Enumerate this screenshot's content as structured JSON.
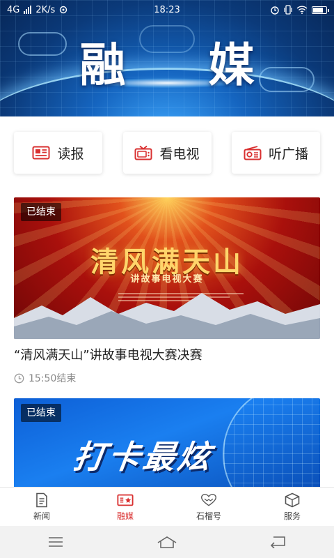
{
  "status_bar": {
    "network": "4G",
    "speed": "2K/s",
    "time": "18:23"
  },
  "banner": {
    "title": "融 媒"
  },
  "quick_entries": [
    {
      "label": "读报",
      "icon": "newspaper-icon"
    },
    {
      "label": "看电视",
      "icon": "tv-icon"
    },
    {
      "label": "听广播",
      "icon": "radio-icon"
    }
  ],
  "live_cards": [
    {
      "badge": "已结束",
      "poster_title": "清风满天山",
      "poster_subtitle": "讲故事电视大赛",
      "title": "“清风满天山”讲故事电视大赛决赛",
      "time_text": "15:50结束"
    },
    {
      "badge": "已结束",
      "poster_title": "打卡最炫"
    }
  ],
  "tab_bar": [
    {
      "label": "新闻",
      "icon": "news-doc-icon",
      "active": false
    },
    {
      "label": "融媒",
      "icon": "media-star-icon",
      "active": true
    },
    {
      "label": "石榴号",
      "icon": "heart-hands-icon",
      "active": false
    },
    {
      "label": "服务",
      "icon": "cube-icon",
      "active": false
    }
  ],
  "colors": {
    "accent": "#d93030",
    "banner_blue": "#1565c0",
    "card_red": "#a9100c"
  }
}
